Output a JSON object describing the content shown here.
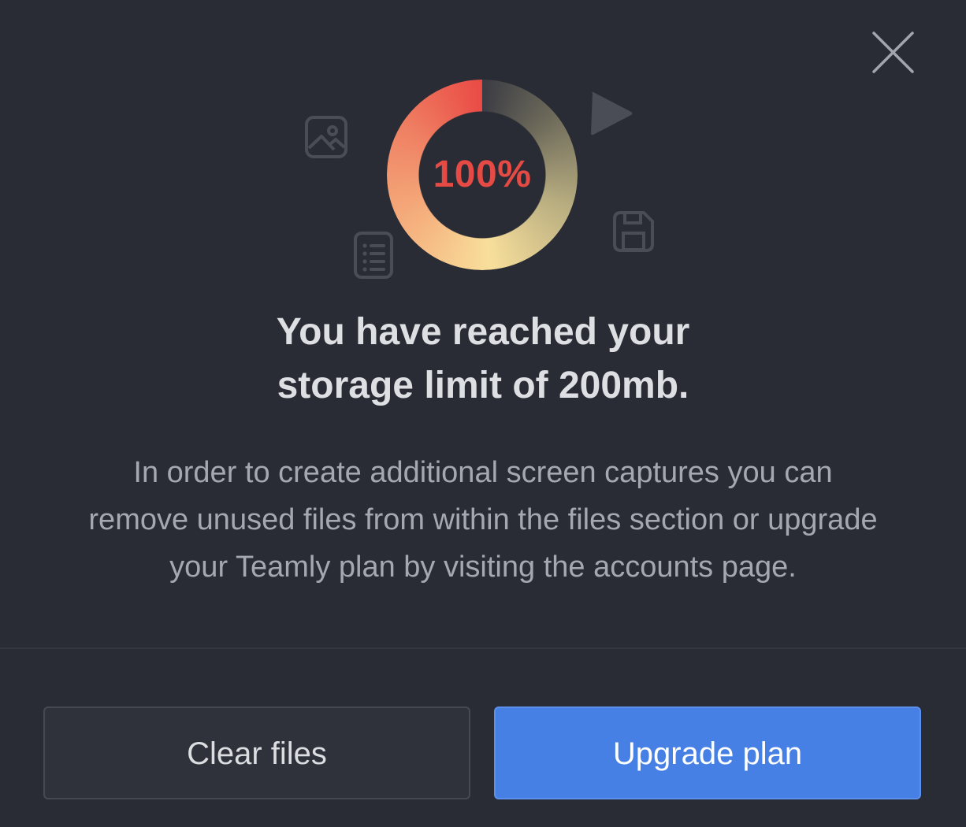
{
  "close_button": {
    "icon": "close-icon"
  },
  "storage": {
    "percent_label": "100%",
    "usage_fraction": 1.0,
    "accent_color": "#e64a44"
  },
  "decorative_icons": [
    "image-icon",
    "play-icon",
    "document-list-icon",
    "floppy-disk-icon"
  ],
  "heading": {
    "line1": "You have reached your",
    "line2": "storage limit of 200mb."
  },
  "body": {
    "line1": "In order to create additional screen captures you can",
    "line2": "remove unused files from within the files section or upgrade",
    "line3": "your Teamly plan by visiting the accounts page."
  },
  "actions": {
    "clear_label": "Clear files",
    "upgrade_label": "Upgrade plan",
    "upgrade_color": "#4780e4"
  }
}
